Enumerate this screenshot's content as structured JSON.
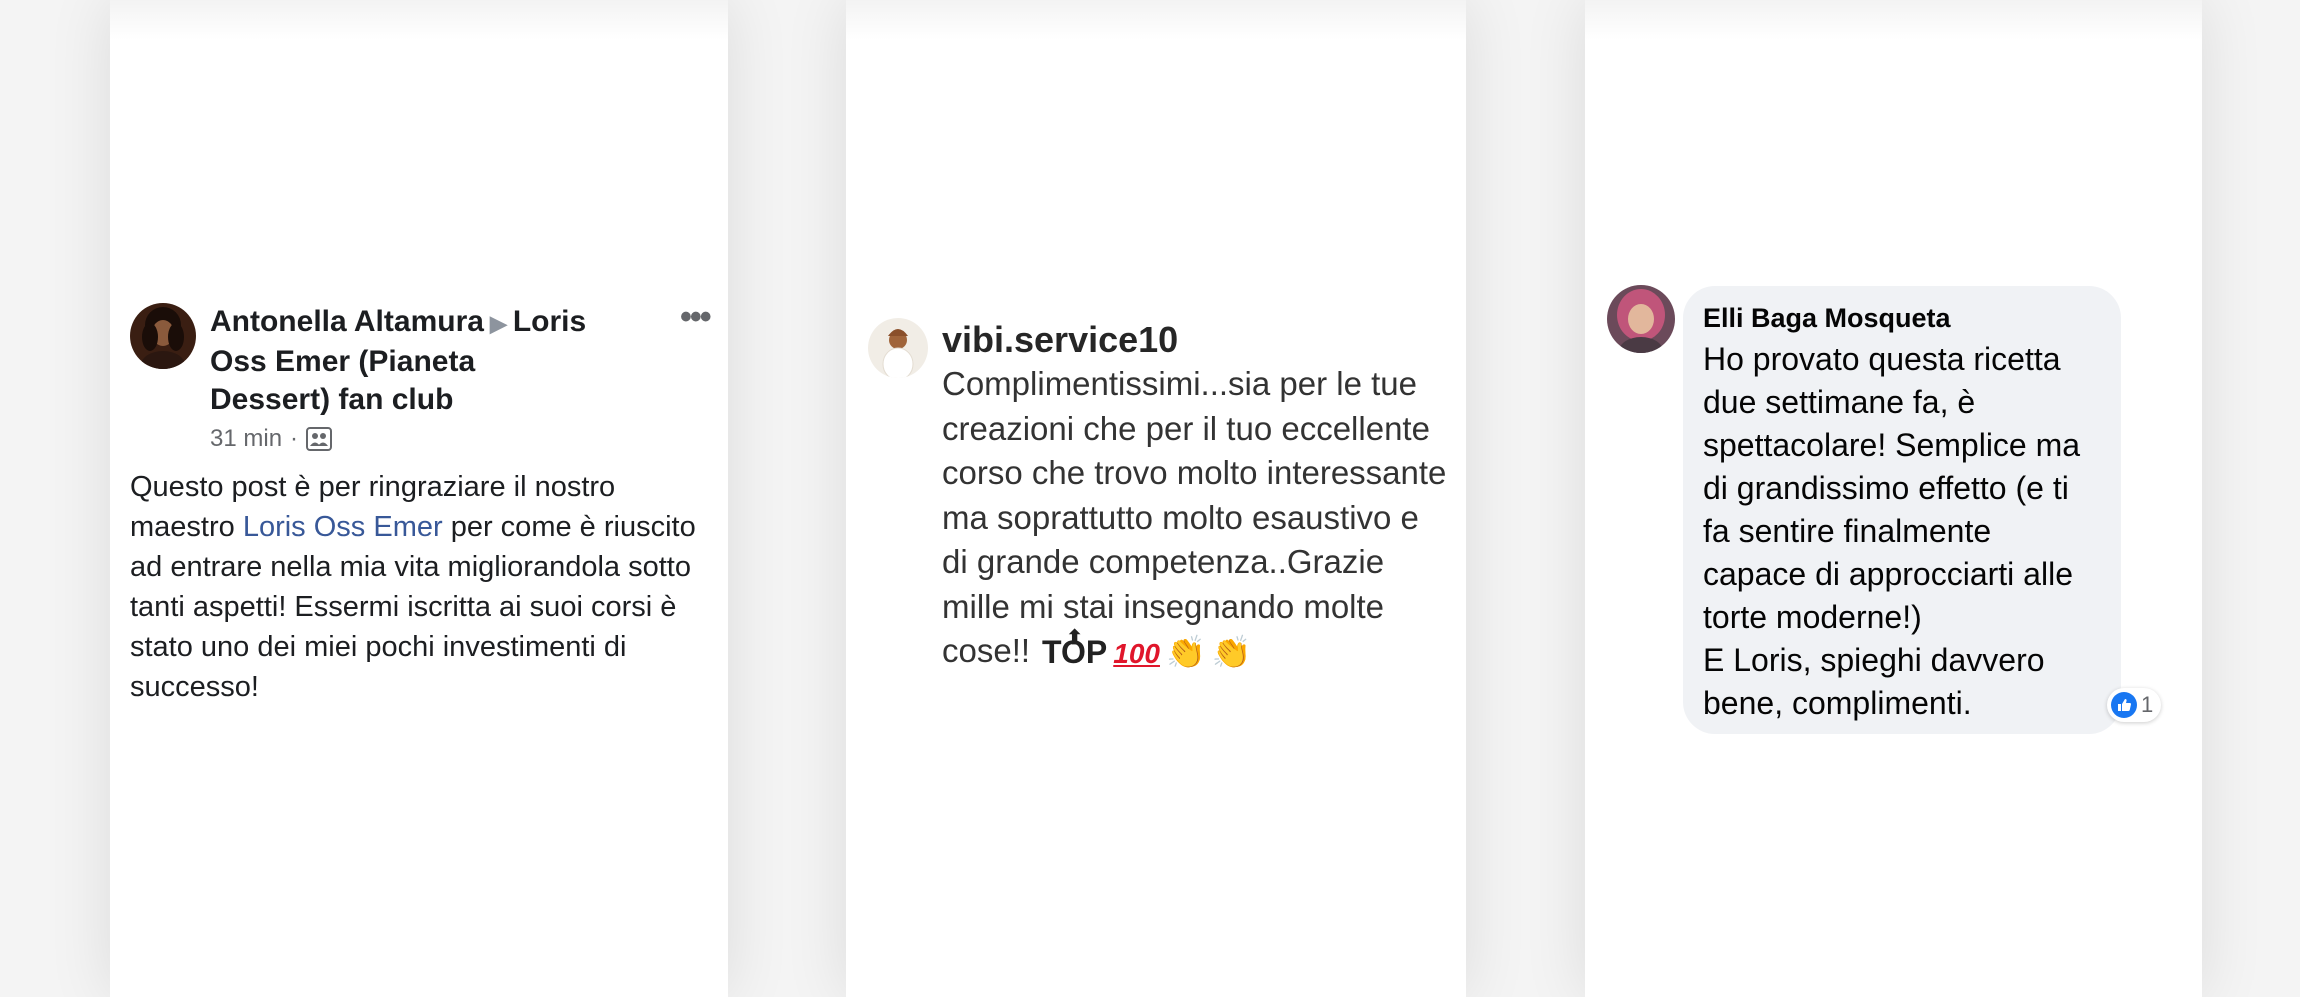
{
  "card1": {
    "author": "Antonella Altamura",
    "separator_icon": "triangle-right-icon",
    "target": "Loris Oss Emer (Pianeta Dessert) fan club",
    "time": "31 min",
    "dot": "·",
    "audience_icon": "group-audience-icon",
    "more_icon": "more-options-icon",
    "body_before": "Questo post è per ringraziare il nostro maestro ",
    "mention": "Loris Oss Emer",
    "body_after": " per come è riuscito ad entrare nella mia vita migliorandola sotto tanti aspetti! Essermi iscritta ai suoi corsi è stato uno dei miei pochi investimenti di successo!",
    "colors": {
      "mention": "#385898",
      "text": "#1c1e21",
      "meta": "#65676b"
    }
  },
  "card2": {
    "username": "vibi.service10",
    "comment": "Complimentissimi...sia per le tue creazioni che per il tuo eccellente corso che trovo molto interessante ma soprattutto molto esaustivo e di grande competenza..Grazie mille mi stai insegnando molte cose!!",
    "emoji_top": "TOP",
    "emoji_hundred": "100",
    "emoji_icons": [
      "top-arrow-icon",
      "hundred-points-icon",
      "clapping-hands-icon",
      "clapping-hands-icon"
    ]
  },
  "card3": {
    "name": "Elli Baga Mosqueta",
    "text": "Ho provato questa ricetta due settimane fa, è spettacolare! Semplice ma di grandissimo effetto (e ti fa sentire finalmente capace di approcciarti alle torte moderne!)\nE Loris, spieghi davvero bene, complimenti.",
    "reaction_icon": "like-icon",
    "reaction_count": "1",
    "colors": {
      "bubble": "#f0f2f5",
      "like": "#1877f2"
    }
  }
}
